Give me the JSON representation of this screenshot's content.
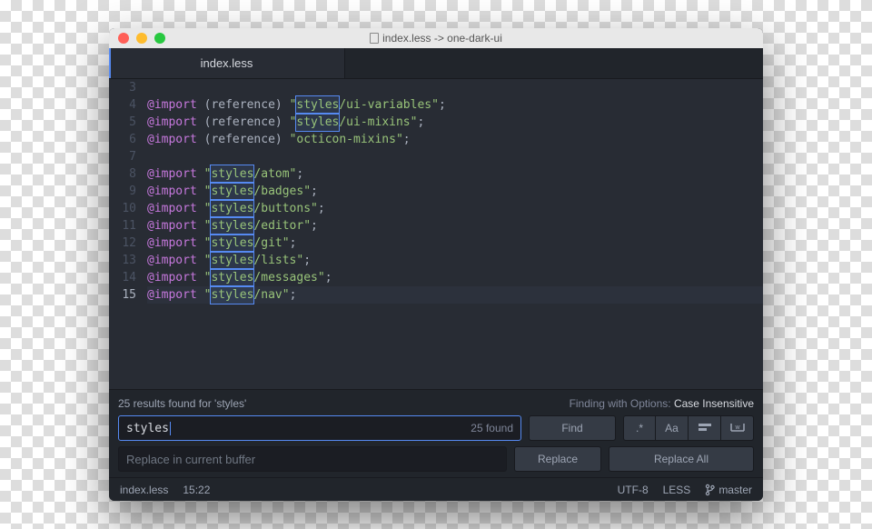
{
  "window": {
    "title": "index.less -> one-dark-ui"
  },
  "tabs": [
    {
      "label": "index.less"
    }
  ],
  "editor": {
    "first_line": 3,
    "current_line": 15,
    "search_term": "styles",
    "lines": [
      {
        "n": 3,
        "type": "blank"
      },
      {
        "n": 4,
        "type": "import_ref",
        "path_pre": "styles",
        "path_post": "/ui-variables"
      },
      {
        "n": 5,
        "type": "import_ref",
        "path_pre": "styles",
        "path_post": "/ui-mixins"
      },
      {
        "n": 6,
        "type": "import_ref_plain",
        "path": "octicon-mixins"
      },
      {
        "n": 7,
        "type": "blank"
      },
      {
        "n": 8,
        "type": "import",
        "path_pre": "styles",
        "path_post": "/atom"
      },
      {
        "n": 9,
        "type": "import",
        "path_pre": "styles",
        "path_post": "/badges"
      },
      {
        "n": 10,
        "type": "import",
        "path_pre": "styles",
        "path_post": "/buttons"
      },
      {
        "n": 11,
        "type": "import",
        "path_pre": "styles",
        "path_post": "/editor"
      },
      {
        "n": 12,
        "type": "import",
        "path_pre": "styles",
        "path_post": "/git"
      },
      {
        "n": 13,
        "type": "import",
        "path_pre": "styles",
        "path_post": "/lists"
      },
      {
        "n": 14,
        "type": "import",
        "path_pre": "styles",
        "path_post": "/messages"
      },
      {
        "n": 15,
        "type": "import",
        "path_pre": "styles",
        "path_post": "/nav"
      }
    ]
  },
  "find": {
    "results_text": "25 results found for 'styles'",
    "options_prefix": "Finding with Options: ",
    "options_value": "Case Insensitive",
    "query": "styles",
    "count_label": "25 found",
    "find_button": "Find",
    "replace_placeholder": "Replace in current buffer",
    "replace_button": "Replace",
    "replace_all_button": "Replace All",
    "toggles": {
      "regex": ".*",
      "case": "Aa",
      "selection_icon": "selection",
      "word_icon": "whole-word"
    }
  },
  "statusbar": {
    "file": "index.less",
    "cursor": "15:22",
    "encoding": "UTF-8",
    "grammar": "LESS",
    "branch": "master"
  }
}
